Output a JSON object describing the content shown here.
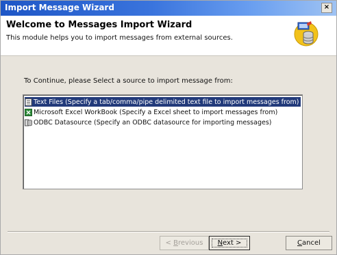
{
  "window": {
    "title": "Import Message Wizard",
    "close_glyph": "×"
  },
  "header": {
    "title": "Welcome to Messages Import Wizard",
    "subtitle": "This module helps you to import messages from external sources.",
    "icon": "database-wizard-icon"
  },
  "main": {
    "prompt": "To Continue, please Select a source to import message from:",
    "sources": [
      {
        "label": "Text Files (Specify a tab/comma/pipe delimited text file to import messages from)",
        "icon": "text-file-icon",
        "selected": true
      },
      {
        "label": "Microsoft Excel WorkBook (Specify a Excel sheet to import messages from)",
        "icon": "excel-icon",
        "selected": false
      },
      {
        "label": "ODBC Datasource (Specify an ODBC datasource for importing messages)",
        "icon": "odbc-datasource-icon",
        "selected": false
      }
    ]
  },
  "buttons": {
    "back": {
      "prefix": "< ",
      "mnemonic": "B",
      "rest": "revious"
    },
    "next": {
      "mnemonic": "N",
      "rest": "ext >"
    },
    "cancel": {
      "mnemonic": "C",
      "rest": "ancel"
    }
  },
  "colors": {
    "titlebar_start": "#1e56c6",
    "titlebar_end": "#9fc3f3",
    "selection": "#223a7a",
    "dialog_bg": "#e8e4dc"
  }
}
